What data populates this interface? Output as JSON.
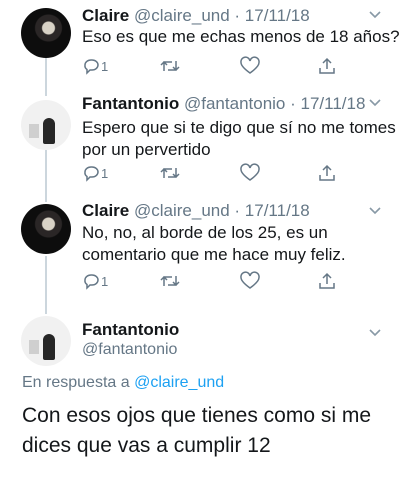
{
  "tweets": [
    {
      "name": "Claire",
      "handle": "@claire_und",
      "date": "17/11/18",
      "text": "Eso es que me echas menos de 18 años?",
      "reply_count": "1"
    },
    {
      "name": "Fantantonio",
      "handle": "@fantantonio",
      "date": "17/11/18",
      "text_line1": "Espero que si te digo que sí no me tomes",
      "text_line2": "por un pervertido",
      "reply_count": "1"
    },
    {
      "name": "Claire",
      "handle": "@claire_und",
      "date": "17/11/18",
      "text_line1": "No, no, al borde de los 25, es un",
      "text_line2": "comentario que me hace muy feliz.",
      "reply_count": "1"
    }
  ],
  "main_tweet": {
    "name": "Fantantonio",
    "handle": "@fantantonio",
    "reply_prefix": "En respuesta a ",
    "reply_handle": "@claire_und",
    "text_line1": "Con esos ojos que tienes como si me",
    "text_line2": "dices que vas a cumplir 12"
  },
  "separator": " · ",
  "colors": {
    "text": "#14171a",
    "secondary": "#657786",
    "link": "#1da1f2",
    "thread_line": "#ccd6dd"
  },
  "icons": [
    "reply-icon",
    "retweet-icon",
    "like-icon",
    "share-icon",
    "chevron-down-icon"
  ]
}
